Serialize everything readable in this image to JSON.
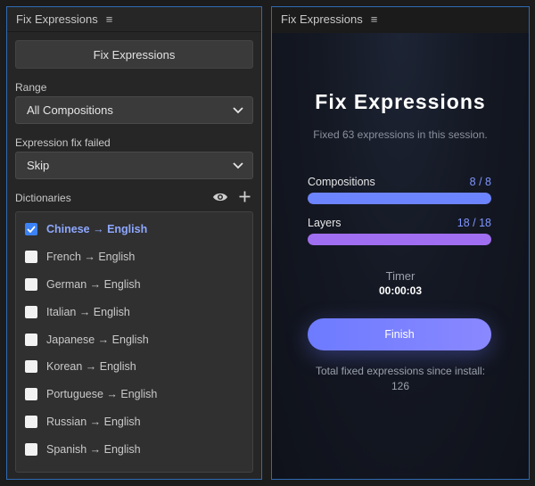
{
  "left_panel": {
    "title": "Fix Expressions",
    "fix_button": "Fix Expressions",
    "range": {
      "label": "Range",
      "value": "All Compositions"
    },
    "fail": {
      "label": "Expression fix failed",
      "value": "Skip"
    },
    "dictionaries": {
      "label": "Dictionaries",
      "items": [
        {
          "label": "Chinese → English",
          "checked": true
        },
        {
          "label": "French → English",
          "checked": false
        },
        {
          "label": "German → English",
          "checked": false
        },
        {
          "label": "Italian → English",
          "checked": false
        },
        {
          "label": "Japanese → English",
          "checked": false
        },
        {
          "label": "Korean → English",
          "checked": false
        },
        {
          "label": "Portuguese → English",
          "checked": false
        },
        {
          "label": "Russian → English",
          "checked": false
        },
        {
          "label": "Spanish → English",
          "checked": false
        }
      ]
    }
  },
  "right_panel": {
    "title": "Fix Expressions",
    "heading": "Fix Expressions",
    "subtitle": "Fixed 63 expressions in this session.",
    "compositions": {
      "label": "Compositions",
      "count": "8 / 8",
      "fraction": 1.0
    },
    "layers": {
      "label": "Layers",
      "count": "18 / 18",
      "fraction": 1.0
    },
    "timer": {
      "label": "Timer",
      "value": "00:00:03"
    },
    "finish_button": "Finish",
    "total_label": "Total fixed expressions since install:",
    "total_value": "126"
  },
  "colors": {
    "panel_border": "#2f6ab3",
    "compositions_bar": "#6d84ff",
    "layers_bar": "#a06ef0",
    "checkbox_checked": "#3b82f6"
  }
}
